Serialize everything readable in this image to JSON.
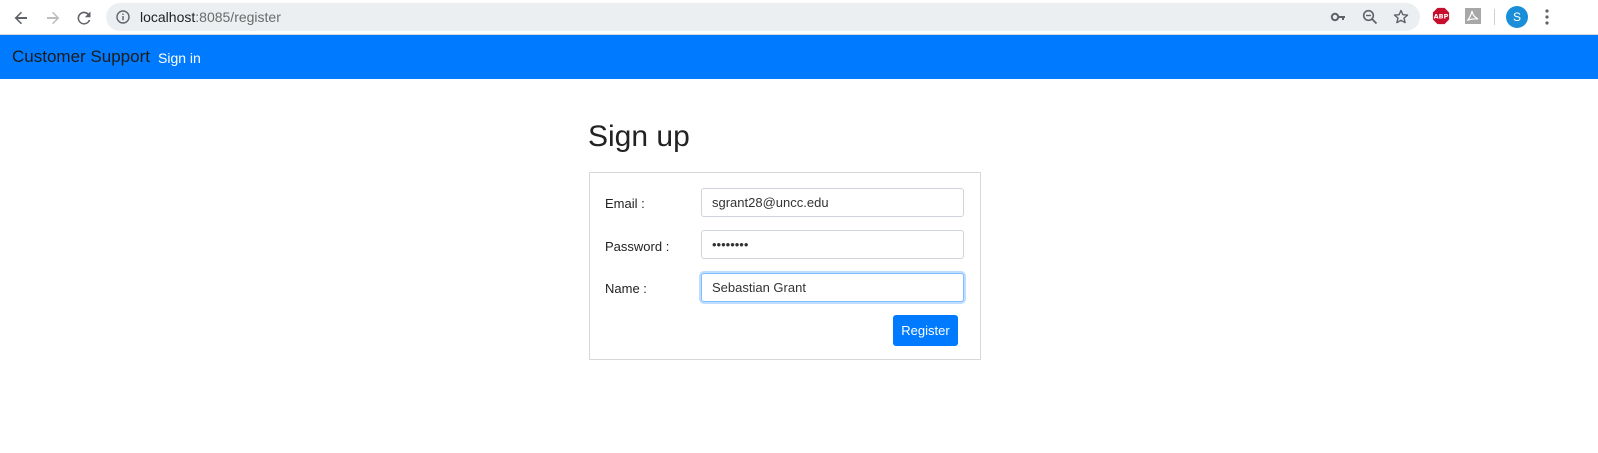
{
  "browser": {
    "url_host": "localhost",
    "url_rest": ":8085/register",
    "profile_initial": "S",
    "abp_label": "ABP"
  },
  "navbar": {
    "brand": "Customer Support",
    "sign_in_link": "Sign in",
    "background_color": "#007bff"
  },
  "page": {
    "title": "Sign up"
  },
  "form": {
    "email_label": "Email :",
    "email_value": "sgrant28@uncc.edu",
    "password_label": "Password :",
    "password_value": "••••••••",
    "name_label": "Name :",
    "name_value": "Sebastian Grant",
    "register_button": "Register"
  },
  "icons": {
    "back": "arrow-back-icon",
    "forward": "arrow-forward-icon",
    "reload": "reload-icon",
    "info": "info-icon",
    "key": "key-icon",
    "zoom": "zoom-out-icon",
    "star": "star-icon",
    "menu": "more-vertical-icon"
  },
  "colors": {
    "accent": "#007bff",
    "focus_ring": "#80bdff"
  }
}
